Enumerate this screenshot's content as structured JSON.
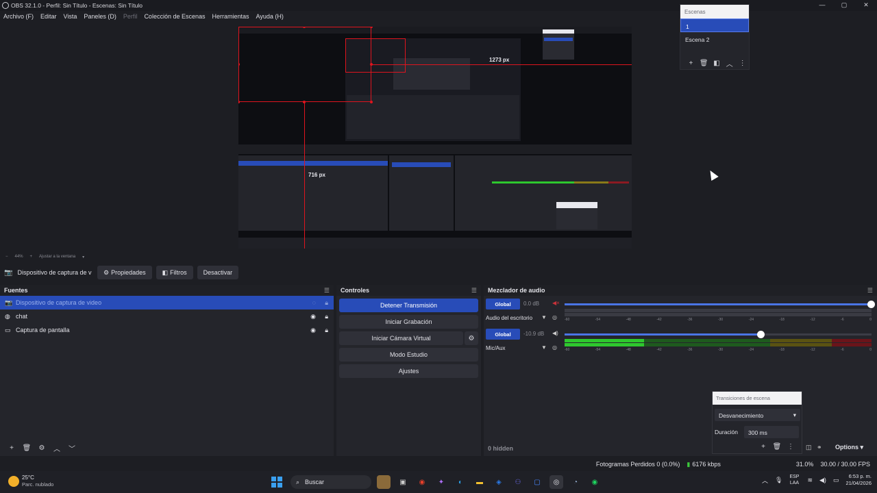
{
  "window": {
    "title": "OBS 32.1.0 - Perfil: Sin Título - Escenas: Sin Título",
    "controls": [
      "—",
      "▢",
      "✕"
    ]
  },
  "menu": [
    {
      "label": "Archivo (F)",
      "disabled": false
    },
    {
      "label": "Editar",
      "disabled": false
    },
    {
      "label": "Vista",
      "disabled": false
    },
    {
      "label": "Paneles (D)",
      "disabled": false
    },
    {
      "label": "Perfil",
      "disabled": true
    },
    {
      "label": "Colección de Escenas",
      "disabled": false
    },
    {
      "label": "Herramientas",
      "disabled": false
    },
    {
      "label": "Ayuda (H)",
      "disabled": false
    }
  ],
  "preview": {
    "width_measure": "1273 px",
    "height_measure": "716 px",
    "zoom": "44%",
    "zoom_mode": "Ajustar a la ventana"
  },
  "scenes": {
    "title": "Escenas",
    "items": [
      "1",
      "Escena 2"
    ],
    "selected": 0
  },
  "context_bar": {
    "source_name": "Dispositivo de captura de v",
    "properties": "Propiedades",
    "filters": "Filtros",
    "deactivate": "Desactivar"
  },
  "sources": {
    "title": "Fuentes",
    "items": [
      {
        "name": "Dispositivo de captura de video",
        "selected": true,
        "visible": false
      },
      {
        "name": "chat",
        "selected": false,
        "visible": true
      },
      {
        "name": "Captura de pantalla",
        "selected": false,
        "visible": true
      }
    ]
  },
  "controls": {
    "title": "Controles",
    "stop_stream": "Detener Transmisión",
    "start_record": "Iniciar Grabación",
    "start_vcam": "Iniciar Cámara Virtual",
    "studio_mode": "Modo Estudio",
    "settings": "Ajustes"
  },
  "mixer": {
    "title": "Mezclador de audio",
    "channels": [
      {
        "badge": "Global",
        "db": "0.0 dB",
        "name": "Audio del escritorio",
        "volume": 1.0,
        "muted": true,
        "level": 0.0
      },
      {
        "badge": "Global",
        "db": "-10.9 dB",
        "name": "Mic/Aux",
        "volume": 0.64,
        "muted": false,
        "level": 0.26
      }
    ],
    "scale": [
      "-60",
      "-54",
      "-48",
      "-42",
      "-36",
      "-30",
      "-24",
      "-18",
      "-12",
      "-6",
      "0"
    ],
    "hidden": "0 hidden",
    "options": "Options"
  },
  "transitions": {
    "title": "Transiciones de escena",
    "selected": "Desvanecimiento",
    "duration_label": "Duración",
    "duration": "300 ms"
  },
  "status": {
    "dropped": "Fotogramas Perdidos 0 (0.0%)",
    "kbps": "6176 kbps",
    "cpu": "31.0%",
    "fps": "30.00 / 30.00 FPS"
  },
  "taskbar": {
    "temp": "25°C",
    "condition": "Parc. nublado",
    "search": "Buscar",
    "lang1": "ESP",
    "lang2": "LAA",
    "time": "6:53 p. m.",
    "date": "21/04/2026"
  },
  "colors": {
    "accent": "#284cb8",
    "guide": "#e0141e",
    "meter_green": "#2ec82e",
    "meter_yellow": "#8a7a18",
    "meter_red": "#8c1a22"
  }
}
